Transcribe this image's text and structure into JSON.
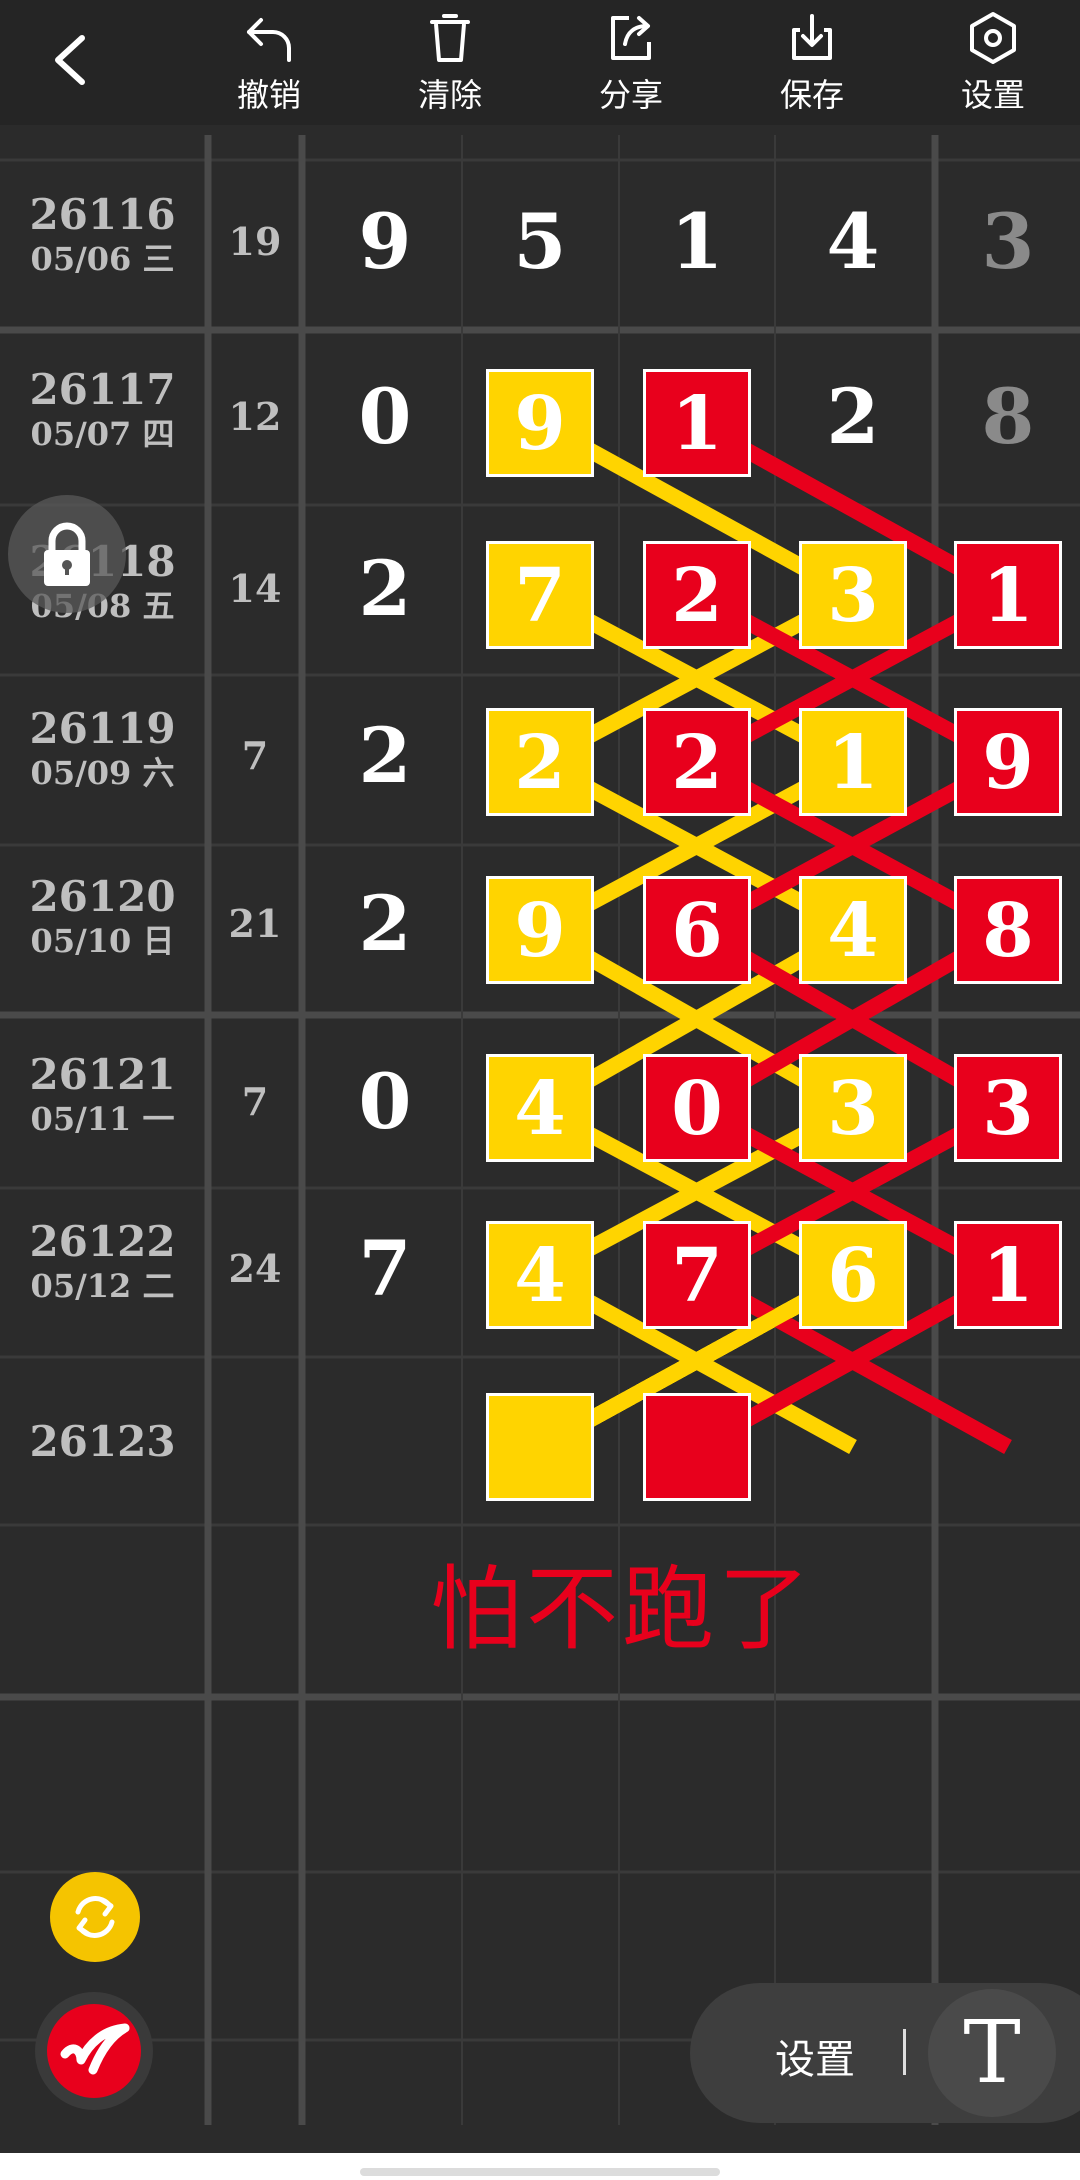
{
  "toolbar": {
    "back_label": "",
    "undo_label": "撤销",
    "clear_label": "清除",
    "share_label": "分享",
    "save_label": "保存",
    "settings_label": "设置"
  },
  "rows": [
    {
      "issue": "26116",
      "date": "05/06 三",
      "sum": "19",
      "digits": [
        "9",
        "5",
        "1",
        "4",
        "3"
      ]
    },
    {
      "issue": "26117",
      "date": "05/07 四",
      "sum": "12",
      "digits": [
        "0",
        "9",
        "1",
        "2",
        "8"
      ]
    },
    {
      "issue": "26118",
      "date": "05/08 五",
      "sum": "14",
      "digits": [
        "2",
        "7",
        "2",
        "3",
        "1"
      ]
    },
    {
      "issue": "26119",
      "date": "05/09 六",
      "sum": "7",
      "digits": [
        "2",
        "2",
        "2",
        "1",
        "9"
      ]
    },
    {
      "issue": "26120",
      "date": "05/10 日",
      "sum": "21",
      "digits": [
        "2",
        "9",
        "6",
        "4",
        "8"
      ]
    },
    {
      "issue": "26121",
      "date": "05/11 一",
      "sum": "7",
      "digits": [
        "0",
        "4",
        "0",
        "3",
        "3"
      ]
    },
    {
      "issue": "26122",
      "date": "05/12 二",
      "sum": "24",
      "digits": [
        "7",
        "4",
        "7",
        "6",
        "1"
      ]
    },
    {
      "issue": "26123",
      "date": "",
      "sum": "",
      "digits": [
        "",
        "",
        "",
        "",
        ""
      ]
    }
  ],
  "annotation": "怕不跑了",
  "bottom": {
    "settings_label": "设置",
    "text_tool_glyph": "T"
  },
  "colors": {
    "yellow": "#ffd400",
    "red": "#e8001c",
    "background": "#2b2b2b"
  },
  "icons": [
    "back-icon",
    "undo-icon",
    "trash-icon",
    "share-icon",
    "download-icon",
    "gear-icon",
    "lock-icon",
    "refresh-icon",
    "app-logo-icon",
    "text-tool-icon"
  ]
}
